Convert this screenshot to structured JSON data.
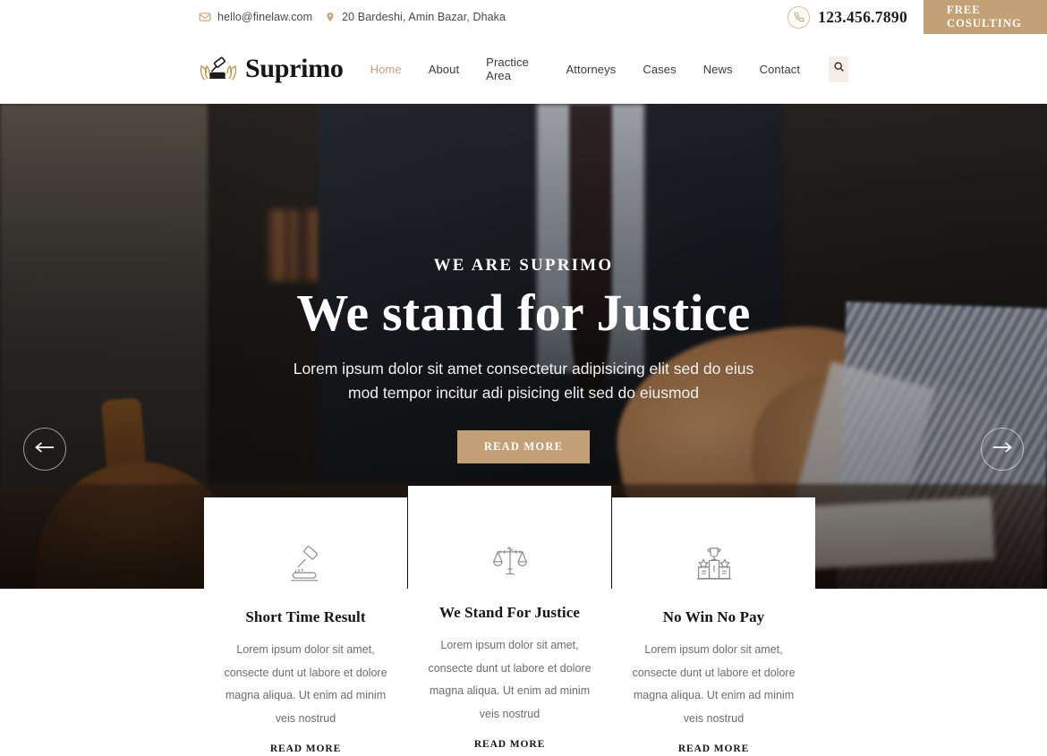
{
  "topbar": {
    "email": "hello@finelaw.com",
    "email_icon": "envelope-icon",
    "address": "20 Bardeshi, Amin Bazar, Dhaka",
    "address_icon": "map-pin-icon",
    "phone": "123.456.7890",
    "phone_icon": "phone-icon",
    "cta_label": "FREE COSULTING",
    "accent_color": "#c4a077"
  },
  "header": {
    "brand": "Suprimo",
    "brand_icon": "gavel-laurel-icon",
    "nav": [
      {
        "label": "Home",
        "active": true
      },
      {
        "label": "About",
        "active": false
      },
      {
        "label": "Practice Area",
        "active": false
      },
      {
        "label": "Attorneys",
        "active": false
      },
      {
        "label": "Cases",
        "active": false
      },
      {
        "label": "News",
        "active": false
      },
      {
        "label": "Contact",
        "active": false
      }
    ],
    "search_icon": "search-icon"
  },
  "hero": {
    "kicker": "WE ARE SUPRIMO",
    "title": "We stand for Justice",
    "subtitle": "Lorem ipsum dolor sit amet consectetur adipisicing elit sed do eius mod tempor incitur adi pisicing elit sed do eiusmod",
    "button_label": "READ MORE",
    "prev_icon": "arrow-left-icon",
    "next_icon": "arrow-right-icon"
  },
  "features": [
    {
      "icon": "gavel-icon",
      "title": "Short Time Result",
      "text": "Lorem ipsum dolor sit amet, consecte dunt ut labore et dolore magna aliqua. Ut enim ad minim veis nostrud",
      "link_label": "READ MORE"
    },
    {
      "icon": "scales-of-justice-icon",
      "title": "We Stand For Justice",
      "text": "Lorem ipsum dolor sit amet, consecte dunt ut labore et dolore magna aliqua. Ut enim ad minim veis nostrud",
      "link_label": "READ MORE"
    },
    {
      "icon": "trophy-podium-icon",
      "title": "No Win No Pay",
      "text": "Lorem ipsum dolor sit amet, consecte dunt ut labore et dolore magna aliqua. Ut enim ad minim veis nostrud",
      "link_label": "READ MORE"
    }
  ]
}
